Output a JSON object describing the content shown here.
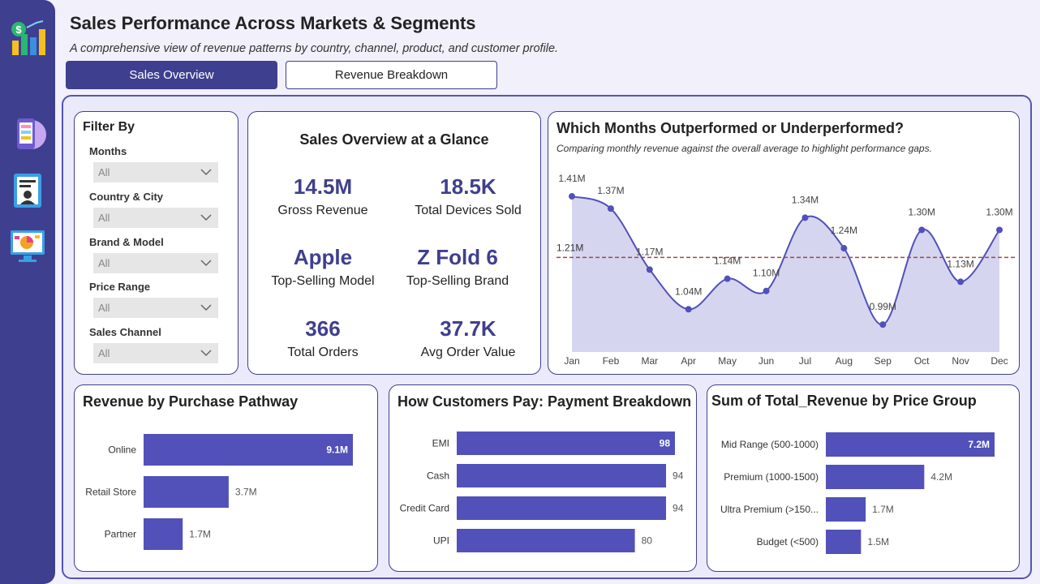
{
  "header": {
    "title": "Sales Performance Across Markets & Segments",
    "subtitle": "A comprehensive view of revenue patterns by country, channel, product, and customer profile."
  },
  "tabs": [
    {
      "label": "Sales Overview",
      "active": true
    },
    {
      "label": "Revenue Breakdown",
      "active": false
    }
  ],
  "rail_icons": [
    "finance-chart-icon",
    "mobile-app-icon",
    "user-profile-icon",
    "dashboard-monitor-icon"
  ],
  "filters": {
    "title": "Filter By",
    "items": [
      {
        "label": "Months",
        "value": "All"
      },
      {
        "label": "Country & City",
        "value": "All"
      },
      {
        "label": "Brand & Model",
        "value": "All"
      },
      {
        "label": "Price Range",
        "value": "All"
      },
      {
        "label": "Sales Channel",
        "value": "All"
      }
    ]
  },
  "kpis": {
    "title": "Sales Overview at a Glance",
    "items": [
      {
        "value": "14.5M",
        "label": "Gross Revenue"
      },
      {
        "value": "18.5K",
        "label": "Total Devices Sold"
      },
      {
        "value": "Apple",
        "label": "Top-Selling Model"
      },
      {
        "value": "Z Fold 6",
        "label": "Top-Selling Brand"
      },
      {
        "value": "366",
        "label": "Total Orders"
      },
      {
        "value": "37.7K",
        "label": "Avg Order Value"
      }
    ]
  },
  "colors": {
    "accent": "#3f3f8f",
    "bar": "#5151b9",
    "area": "#d6d5f0",
    "line": "#5151b9",
    "avg_line": "#9b4a4a"
  },
  "chart_data": [
    {
      "type": "area",
      "title": "Which Months Outperformed or Underperformed?",
      "subtitle": "Comparing monthly revenue against the overall average to highlight performance gaps.",
      "x": [
        "Jan",
        "Feb",
        "Mar",
        "Apr",
        "May",
        "Jun",
        "Jul",
        "Aug",
        "Sep",
        "Oct",
        "Nov",
        "Dec"
      ],
      "values": [
        1.41,
        1.37,
        1.17,
        1.04,
        1.14,
        1.1,
        1.34,
        1.24,
        0.99,
        1.3,
        1.13,
        1.3
      ],
      "labels": [
        "1.41M",
        "1.37M",
        "1.17M",
        "1.04M",
        "1.14M",
        "1.10M",
        "1.34M",
        "1.24M",
        "0.99M",
        "1.30M",
        "1.13M",
        "1.30M"
      ],
      "average": 1.21,
      "average_label": "1.21M",
      "ylim": [
        0.9,
        1.45
      ]
    },
    {
      "type": "bar",
      "orientation": "horizontal",
      "title": "Revenue by Purchase Pathway",
      "categories": [
        "Online",
        "Retail Store",
        "Partner"
      ],
      "values": [
        9.1,
        3.7,
        1.7
      ],
      "labels": [
        "9.1M",
        "3.7M",
        "1.7M"
      ]
    },
    {
      "type": "bar",
      "orientation": "horizontal",
      "title": "How Customers Pay: Payment Breakdown",
      "categories": [
        "EMI",
        "Cash",
        "Credit Card",
        "UPI"
      ],
      "values": [
        98,
        94,
        94,
        80
      ],
      "labels": [
        "98",
        "94",
        "94",
        "80"
      ]
    },
    {
      "type": "bar",
      "orientation": "horizontal",
      "title": "Sum of Total_Revenue by Price Group",
      "categories": [
        "Mid Range (500-1000)",
        "Premium (1000-1500)",
        "Ultra Premium (>150...",
        "Budget (<500)"
      ],
      "values": [
        7.2,
        4.2,
        1.7,
        1.5
      ],
      "labels": [
        "7.2M",
        "4.2M",
        "1.7M",
        "1.5M"
      ]
    }
  ]
}
